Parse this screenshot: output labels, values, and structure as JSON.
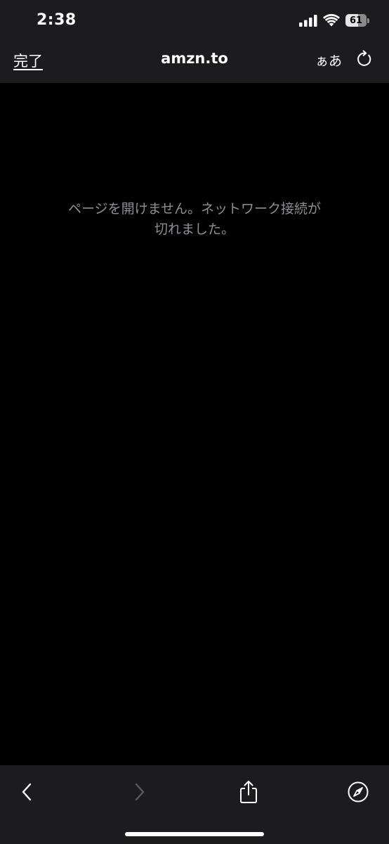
{
  "status_bar": {
    "time": "2:38",
    "battery_level": "61",
    "icons": [
      "cellular-signal-icon",
      "wifi-icon",
      "battery-icon"
    ]
  },
  "nav": {
    "done_label": "完了",
    "title": "amzn.to",
    "text_size_label": "ぁあ",
    "reload_icon": "reload-icon"
  },
  "content": {
    "error_line1": "ページを開けません。ネットワーク接続が",
    "error_line2": "切れました。"
  },
  "toolbar": {
    "icons": [
      "back-icon",
      "forward-icon",
      "share-icon",
      "safari-compass-icon"
    ],
    "forward_enabled": false
  },
  "colors": {
    "chrome_background": "#1c1c1e",
    "page_background": "#000000",
    "error_text": "#8e8e93",
    "disabled_icon": "#5a5a5e"
  }
}
